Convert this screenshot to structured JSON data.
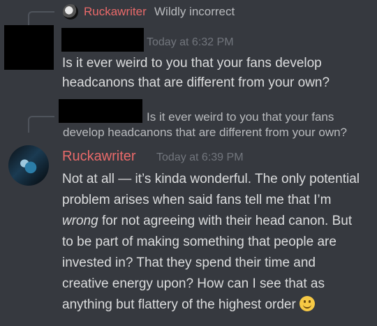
{
  "reply1": {
    "author": "Ruckawriter",
    "text": "Wildly incorrect"
  },
  "message1": {
    "timestamp": "Today at 6:32 PM",
    "line1": "Is it ever weird to you that your fans develop",
    "line2": "headcanons that are different from your own?"
  },
  "reply2": {
    "line1": "Is it ever weird to you that your fans",
    "line2": "develop headcanons that are different from your own?"
  },
  "message2": {
    "author": "Ruckawriter",
    "timestamp": "Today at 6:39 PM",
    "line1": "Not at all — it’s kinda wonderful. The only potential",
    "line2": "problem arises when said fans tell me that I’m",
    "line3_em": "wrong",
    "line3_rest": " for not agreeing with their head canon. But",
    "line4": "to be part of making something that people are",
    "line5": "invested in? That they spend their time and",
    "line6": "creative energy upon? How can I see that as",
    "line7": "anything but flattery of the highest order",
    "emoji": "slightly-smiling-face"
  },
  "colors": {
    "background": "#36393f",
    "author": "#e96a6a",
    "text": "#dcddde",
    "muted": "#72767d"
  }
}
